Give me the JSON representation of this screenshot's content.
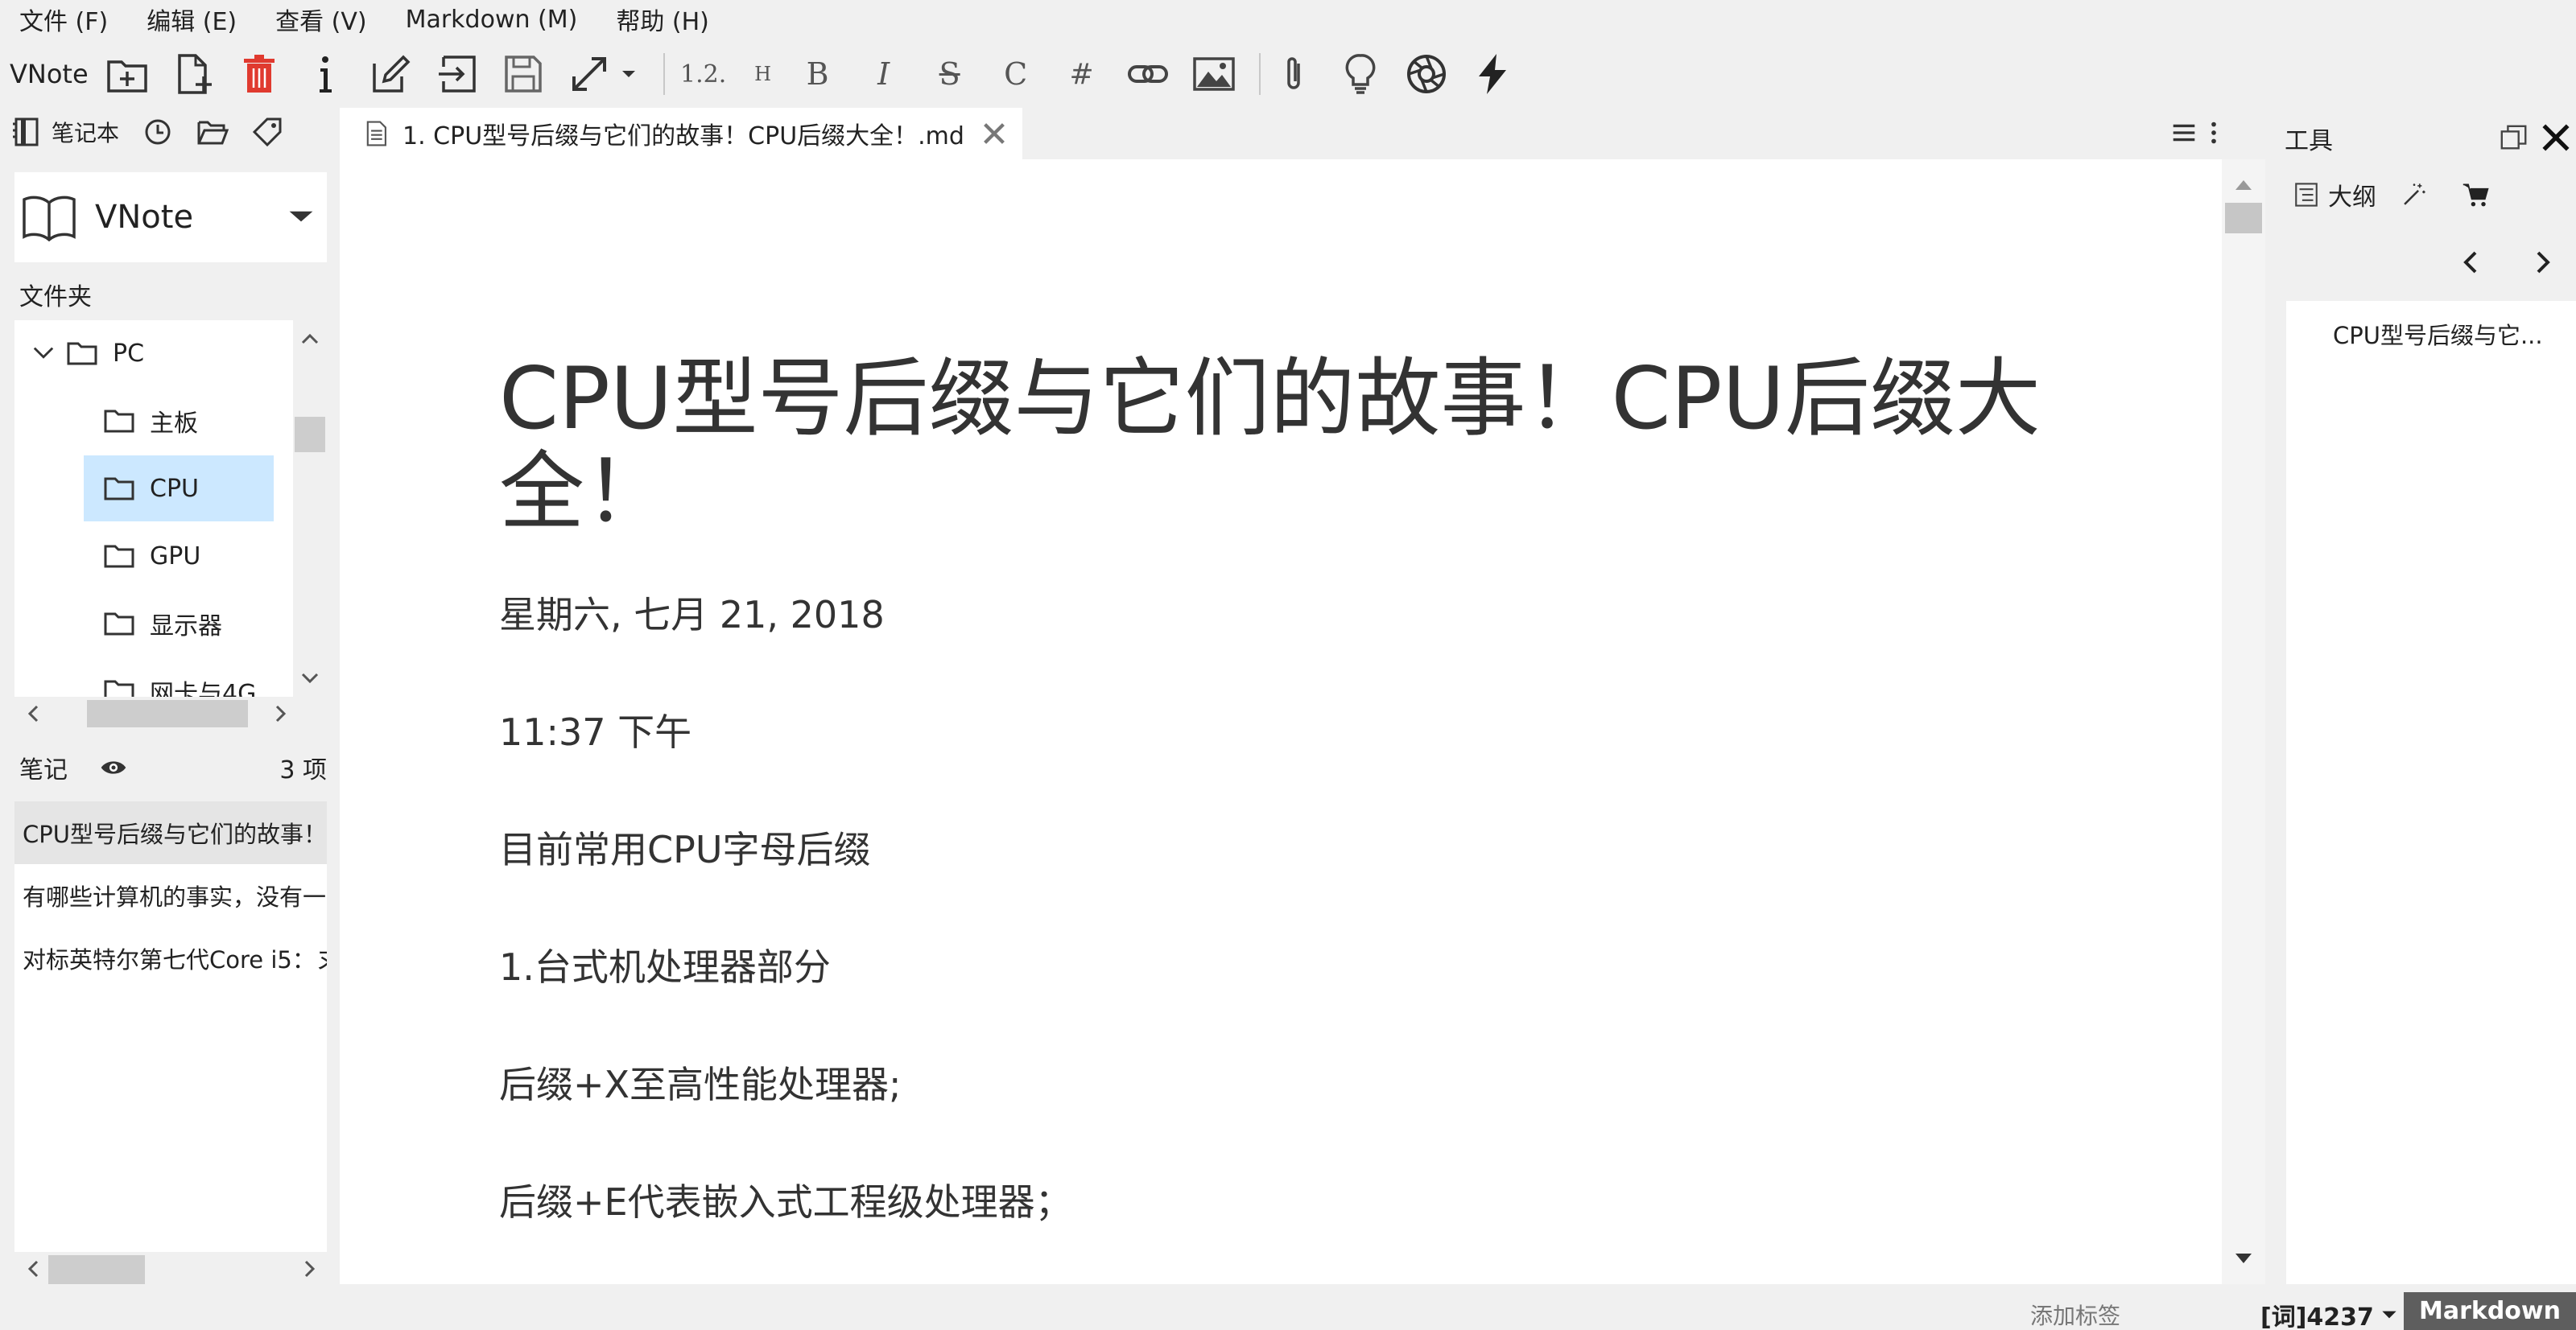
{
  "menubar": [
    "文件 (F)",
    "编辑 (E)",
    "查看 (V)",
    "Markdown (M)",
    "帮助 (H)"
  ],
  "toolbar": {
    "app_label": "VNote",
    "list_glyph": "1.2.",
    "heading_glyph": "H",
    "bold_glyph": "B",
    "italic_glyph": "I",
    "strike_glyph": "S",
    "code_glyph": "C",
    "hash_glyph": "#"
  },
  "left_panel": {
    "notebooks_tab": "笔记本",
    "notebook_name": "VNote",
    "folders_label": "文件夹",
    "tree": [
      {
        "label": "PC",
        "level": 0,
        "expanded": true
      },
      {
        "label": "主板",
        "level": 1
      },
      {
        "label": "CPU",
        "level": 1,
        "selected": true
      },
      {
        "label": "GPU",
        "level": 1
      },
      {
        "label": "显示器",
        "level": 1
      },
      {
        "label": "网卡与4G",
        "level": 1
      }
    ],
    "notes_label": "笔记",
    "notes_count": "3 项",
    "notes": [
      "CPU型号后缀与它们的故事！",
      "有哪些计算机的事实，没有一",
      "对标英特尔第七代Core i5：ヌ"
    ]
  },
  "editor": {
    "tab_title": "1. CPU型号后缀与它们的故事！CPU后缀大全！.md",
    "title": "CPU型号后缀与它们的故事！CPU后缀大全！",
    "paragraphs": [
      "星期六, 七月 21, 2018",
      "11:37 下午",
      "目前常用CPU字母后缀",
      "1.台式机处理器部分",
      "后缀+X至高性能处理器;",
      "后缀+E代表嵌入式工程级处理器；"
    ]
  },
  "right_panel": {
    "tools_label": "工具",
    "outline_tab": "大纲",
    "outline_items": [
      "CPU型号后缀与它..."
    ]
  },
  "status": {
    "add_tag": "添加标签",
    "word_count": "[词]4237",
    "mode": "Markdown"
  },
  "colors": {
    "selection": "#cce8ff",
    "delete_red": "#e03a2f",
    "mode_badge": "#5e5e5e"
  }
}
